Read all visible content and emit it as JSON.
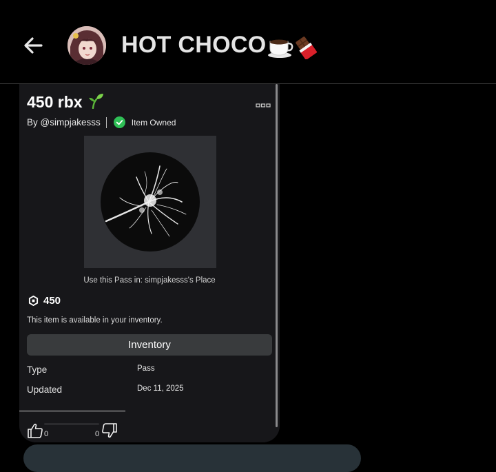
{
  "header": {
    "title": "HOT CHOCO",
    "title_emojis": [
      "hot-beverage",
      "chocolate-bar"
    ],
    "back_icon": "arrow-left-icon",
    "avatar": "contact-avatar"
  },
  "item": {
    "title": "450 rbx",
    "title_emoji": "seedling",
    "by": "By @simpjakesss",
    "owned_label": "Item Owned",
    "use_pass_text": "Use this Pass in: simpjakesss's Place",
    "price": "450",
    "available_text": "This item is available in your inventory.",
    "inventory_button": "Inventory",
    "details": {
      "type_label": "Type",
      "type_value": "Pass",
      "updated_label": "Updated",
      "updated_value": "Dec 11, 2025"
    },
    "votes": {
      "up": "0",
      "down": "0"
    }
  },
  "colors": {
    "background": "#000000",
    "card": "#17171a",
    "button": "#393b3d",
    "owned_check": "#2fbf56",
    "next_bubble": "#283238"
  }
}
